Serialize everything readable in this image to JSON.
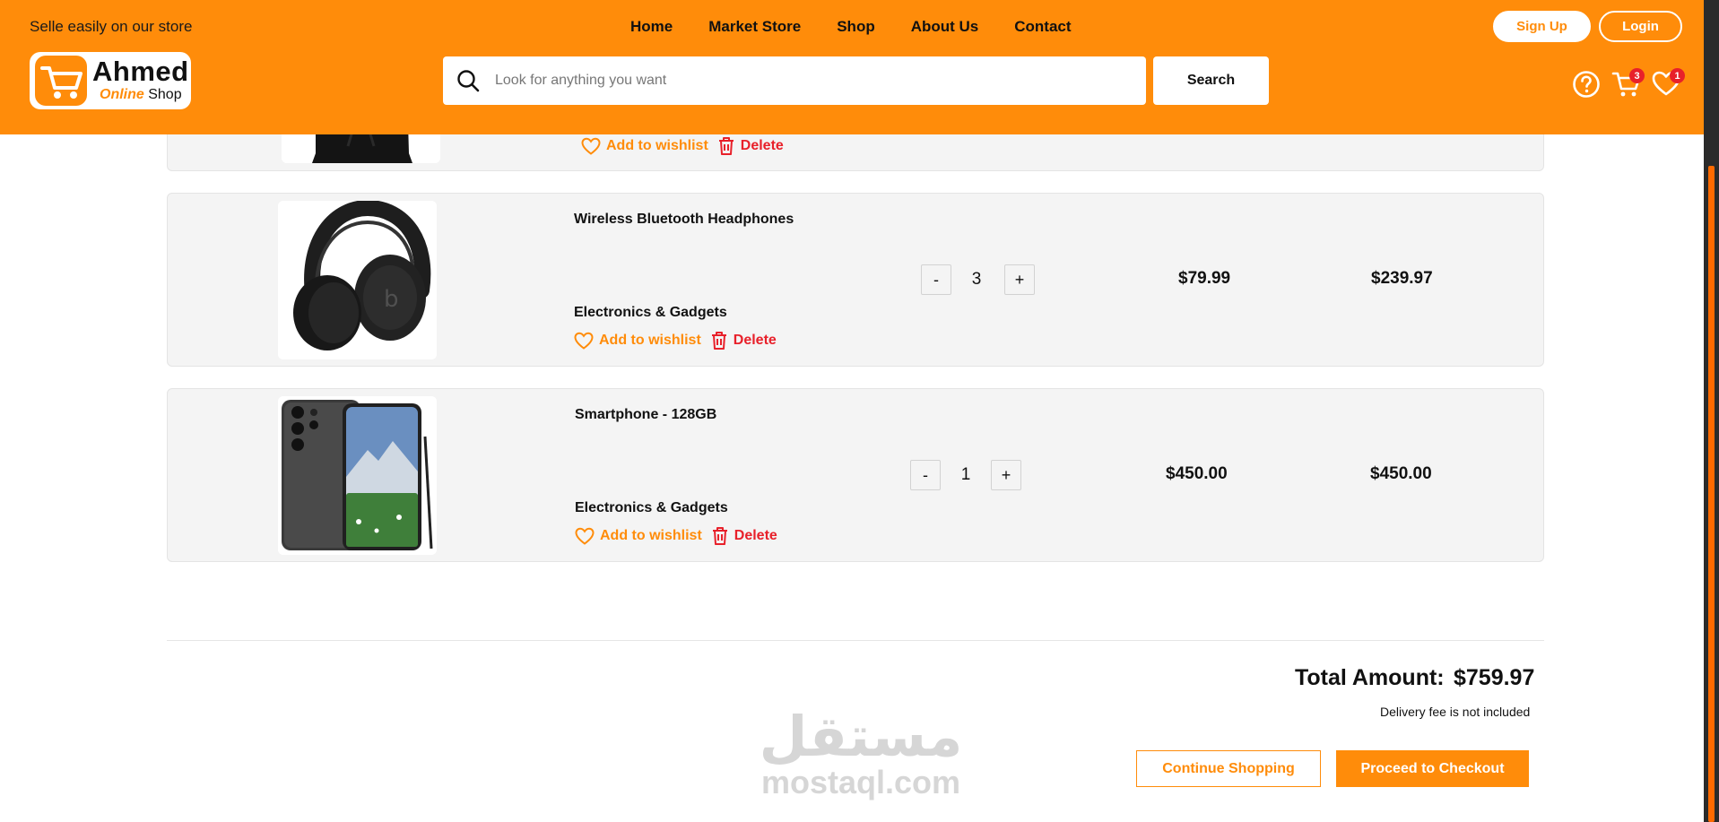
{
  "header": {
    "tagline": "Selle easily on our store",
    "nav": [
      "Home",
      "Market Store",
      "Shop",
      "About Us",
      "Contact"
    ],
    "signup_label": "Sign Up",
    "login_label": "Login",
    "logo_name": "Ahmed",
    "logo_sub_accent": "Online",
    "logo_sub_rest": "Shop",
    "search_placeholder": "Look for anything you want",
    "search_button": "Search",
    "cart_count": "3",
    "wishlist_count": "1"
  },
  "cart": {
    "items": [
      {
        "name": "",
        "category": "",
        "wishlist_label": "Add to wishlist",
        "delete_label": "Delete"
      },
      {
        "name": "Wireless Bluetooth Headphones",
        "category": "Electronics & Gadgets",
        "quantity": "3",
        "unit_price": "$79.99",
        "subtotal": "$239.97",
        "wishlist_label": "Add to wishlist",
        "delete_label": "Delete"
      },
      {
        "name": "Smartphone - 128GB",
        "category": "Electronics & Gadgets",
        "quantity": "1",
        "unit_price": "$450.00",
        "subtotal": "$450.00",
        "wishlist_label": "Add to wishlist",
        "delete_label": "Delete"
      }
    ],
    "minus_label": "-",
    "plus_label": "+"
  },
  "summary": {
    "total_label": "Total Amount:",
    "total_value": "$759.97",
    "delivery_note": "Delivery fee is not included",
    "continue_label": "Continue Shopping",
    "checkout_label": "Proceed to Checkout"
  },
  "watermark": {
    "arabic": "مستقل",
    "latin": "mostaql.com"
  },
  "colors": {
    "brand": "#ff8c0a",
    "danger": "#e8202a"
  }
}
